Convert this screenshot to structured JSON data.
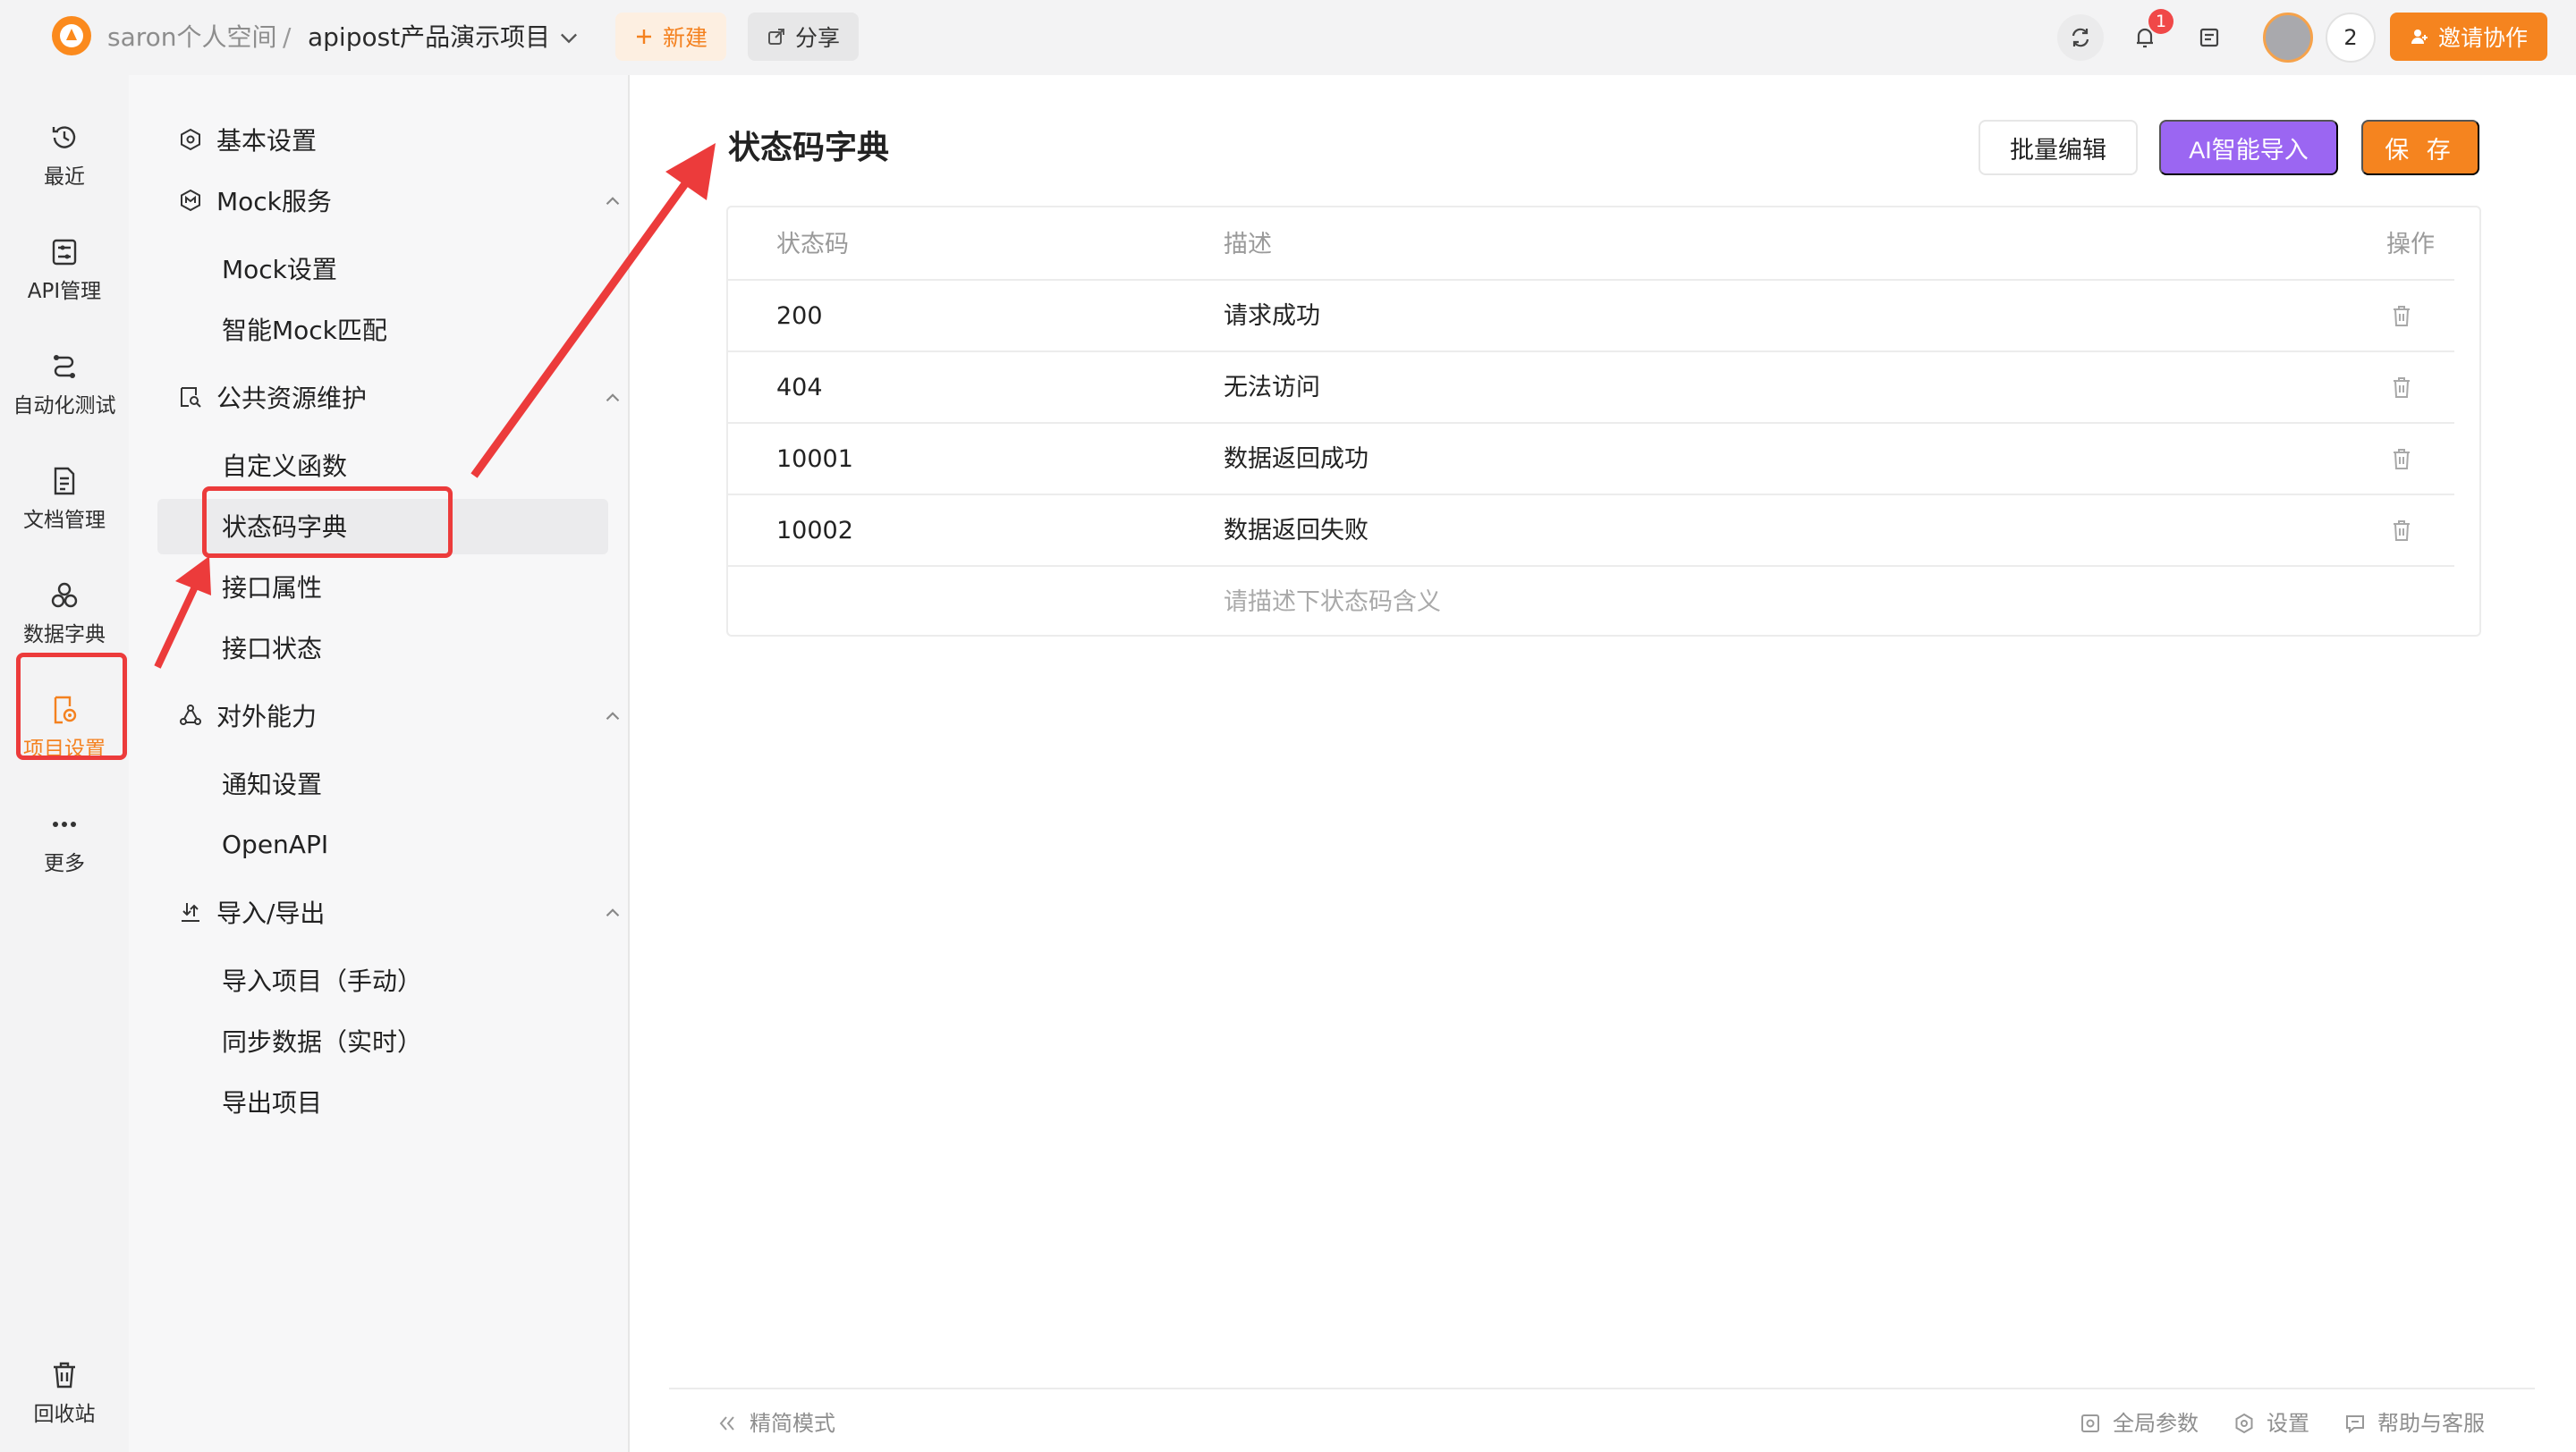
{
  "topbar": {
    "workspace": "saron个人空间",
    "separator": "/",
    "project": "apipost产品演示项目",
    "new_label": "新建",
    "share_label": "分享",
    "notification_count": "1",
    "member_count": "2",
    "invite_label": "邀请协作"
  },
  "rail": {
    "items": [
      {
        "label": "最近",
        "icon": "history-icon"
      },
      {
        "label": "API管理",
        "icon": "api-icon"
      },
      {
        "label": "自动化测试",
        "icon": "flow-icon"
      },
      {
        "label": "文档管理",
        "icon": "document-icon"
      },
      {
        "label": "数据字典",
        "icon": "dictionary-icon"
      },
      {
        "label": "项目设置",
        "icon": "project-settings-icon"
      },
      {
        "label": "更多",
        "icon": "more-icon"
      }
    ],
    "recycle_label": "回收站"
  },
  "submenu": {
    "basic": "基本设置",
    "mock_group": "Mock服务",
    "mock_settings": "Mock设置",
    "smart_mock": "智能Mock匹配",
    "public_group": "公共资源维护",
    "custom_func": "自定义函数",
    "status_dict": "状态码字典",
    "api_attr": "接口属性",
    "api_status": "接口状态",
    "external_group": "对外能力",
    "notify": "通知设置",
    "openapi": "OpenAPI",
    "io_group": "导入/导出",
    "import_manual": "导入项目（手动）",
    "sync_realtime": "同步数据（实时）",
    "export": "导出项目"
  },
  "main": {
    "title": "状态码字典",
    "batch_edit": "批量编辑",
    "ai_import": "AI智能导入",
    "save": "保 存",
    "table": {
      "headers": {
        "code": "状态码",
        "desc": "描述",
        "action": "操作"
      },
      "rows": [
        {
          "code": "200",
          "desc": "请求成功"
        },
        {
          "code": "404",
          "desc": "无法访问"
        },
        {
          "code": "10001",
          "desc": "数据返回成功"
        },
        {
          "code": "10002",
          "desc": "数据返回失败"
        }
      ],
      "new_desc_placeholder": "请描述下状态码含义"
    }
  },
  "footer": {
    "simple_mode": "精简模式",
    "global_params": "全局参数",
    "settings": "设置",
    "help": "帮助与客服"
  },
  "colors": {
    "accent": "#f5841f",
    "ai_button": "#9b66f2",
    "annotation": "#ec3b3b"
  }
}
